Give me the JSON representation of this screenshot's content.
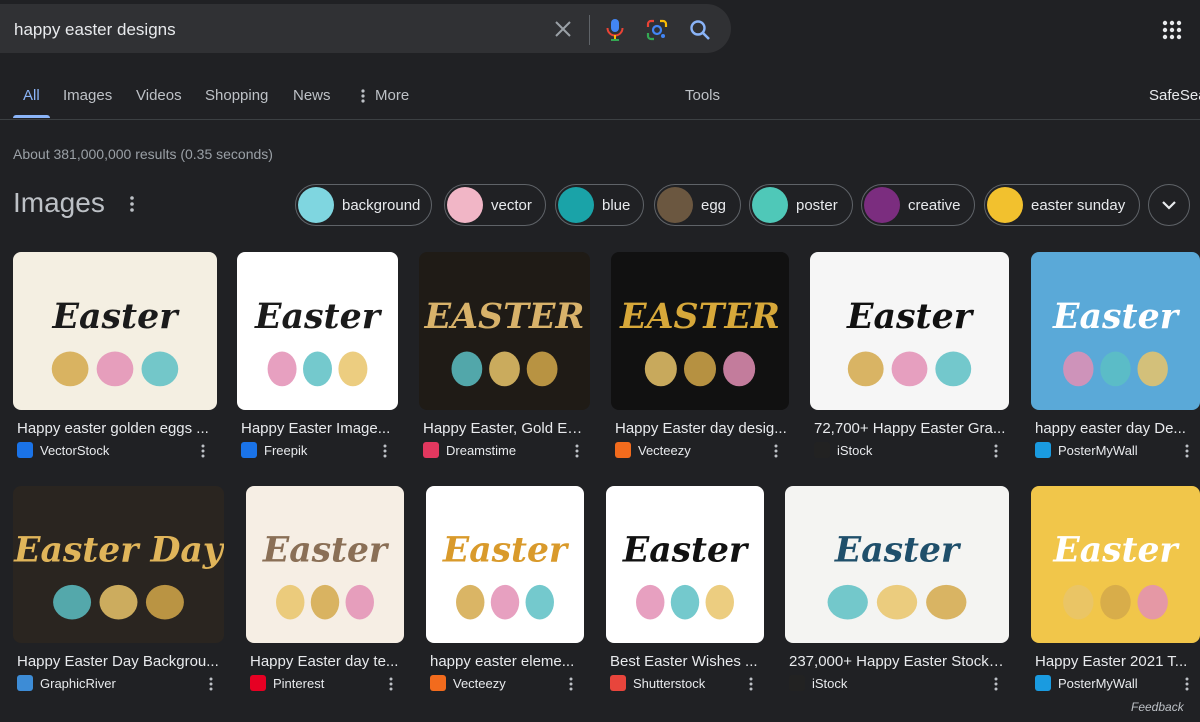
{
  "search": {
    "query": "happy easter designs"
  },
  "tabs": [
    {
      "label": "All",
      "active": true
    },
    {
      "label": "Images"
    },
    {
      "label": "Videos"
    },
    {
      "label": "Shopping"
    },
    {
      "label": "News"
    },
    {
      "label": "More"
    }
  ],
  "tools_label": "Tools",
  "safesearch_label": "SafeSea",
  "stats": "About 381,000,000 results (0.35 seconds)",
  "images_heading": "Images",
  "chips": [
    {
      "label": "background",
      "color": "#7fd6e0"
    },
    {
      "label": "vector",
      "color": "#f1b6c6"
    },
    {
      "label": "blue",
      "color": "#1aa3a8"
    },
    {
      "label": "egg",
      "color": "#6b5740"
    },
    {
      "label": "poster",
      "color": "#4fc8b8"
    },
    {
      "label": "creative",
      "color": "#7b2d7f"
    },
    {
      "label": "easter sunday",
      "color": "#f2c12e"
    }
  ],
  "results": [
    {
      "title": "Happy easter golden eggs ...",
      "source": "VectorStock",
      "favicon_color": "#1a73e8",
      "thumb_text": "Easter",
      "thumb_bg": "#f4efe2",
      "thumb_fg": "#1b1b1b"
    },
    {
      "title": "Happy Easter Image...",
      "source": "Freepik",
      "favicon_color": "#1a73e8",
      "thumb_text": "Easter",
      "thumb_bg": "#ffffff",
      "thumb_fg": "#1b1b1b"
    },
    {
      "title": "Happy Easter, Gold Ea...",
      "source": "Dreamstime",
      "favicon_color": "#e2385f",
      "thumb_text": "EASTER",
      "thumb_bg": "#1f1b16",
      "thumb_fg": "#d8b26a"
    },
    {
      "title": "Happy Easter day desig...",
      "source": "Vecteezy",
      "favicon_color": "#f26b1d",
      "thumb_text": "EASTER",
      "thumb_bg": "#111111",
      "thumb_fg": "#d7a83a"
    },
    {
      "title": "72,700+ Happy Easter Gra...",
      "source": "iStock",
      "favicon_color": "#222222",
      "thumb_text": "Easter",
      "thumb_bg": "#f6f6f6",
      "thumb_fg": "#111111"
    },
    {
      "title": "happy easter day De...",
      "source": "PosterMyWall",
      "favicon_color": "#1a9be0",
      "thumb_text": "Easter",
      "thumb_bg": "#5aa9d8",
      "thumb_fg": "#ffffff"
    },
    {
      "title": "Happy Easter Day Backgrou...",
      "source": "GraphicRiver",
      "favicon_color": "#3d8cd6",
      "thumb_text": "Easter Day",
      "thumb_bg": "#2a2520",
      "thumb_fg": "#e0b55a"
    },
    {
      "title": "Happy Easter day te...",
      "source": "Pinterest",
      "favicon_color": "#e60023",
      "thumb_text": "Easter",
      "thumb_bg": "#f6eee4",
      "thumb_fg": "#8a6f56"
    },
    {
      "title": "happy easter eleme...",
      "source": "Vecteezy",
      "favicon_color": "#f26b1d",
      "thumb_text": "Easter",
      "thumb_bg": "#ffffff",
      "thumb_fg": "#d99a2b"
    },
    {
      "title": "Best Easter Wishes ...",
      "source": "Shutterstock",
      "favicon_color": "#e8453c",
      "thumb_text": "Easter",
      "thumb_bg": "#ffffff",
      "thumb_fg": "#111111"
    },
    {
      "title": "237,000+ Happy Easter Stock I...",
      "source": "iStock",
      "favicon_color": "#222222",
      "thumb_text": "Easter",
      "thumb_bg": "#f4f4f2",
      "thumb_fg": "#1f4f6b"
    },
    {
      "title": "Happy Easter 2021 T...",
      "source": "PosterMyWall",
      "favicon_color": "#1a9be0",
      "thumb_text": "Easter",
      "thumb_bg": "#f1c64a",
      "thumb_fg": "#ffffff"
    }
  ],
  "feedback_label": "Feedback"
}
